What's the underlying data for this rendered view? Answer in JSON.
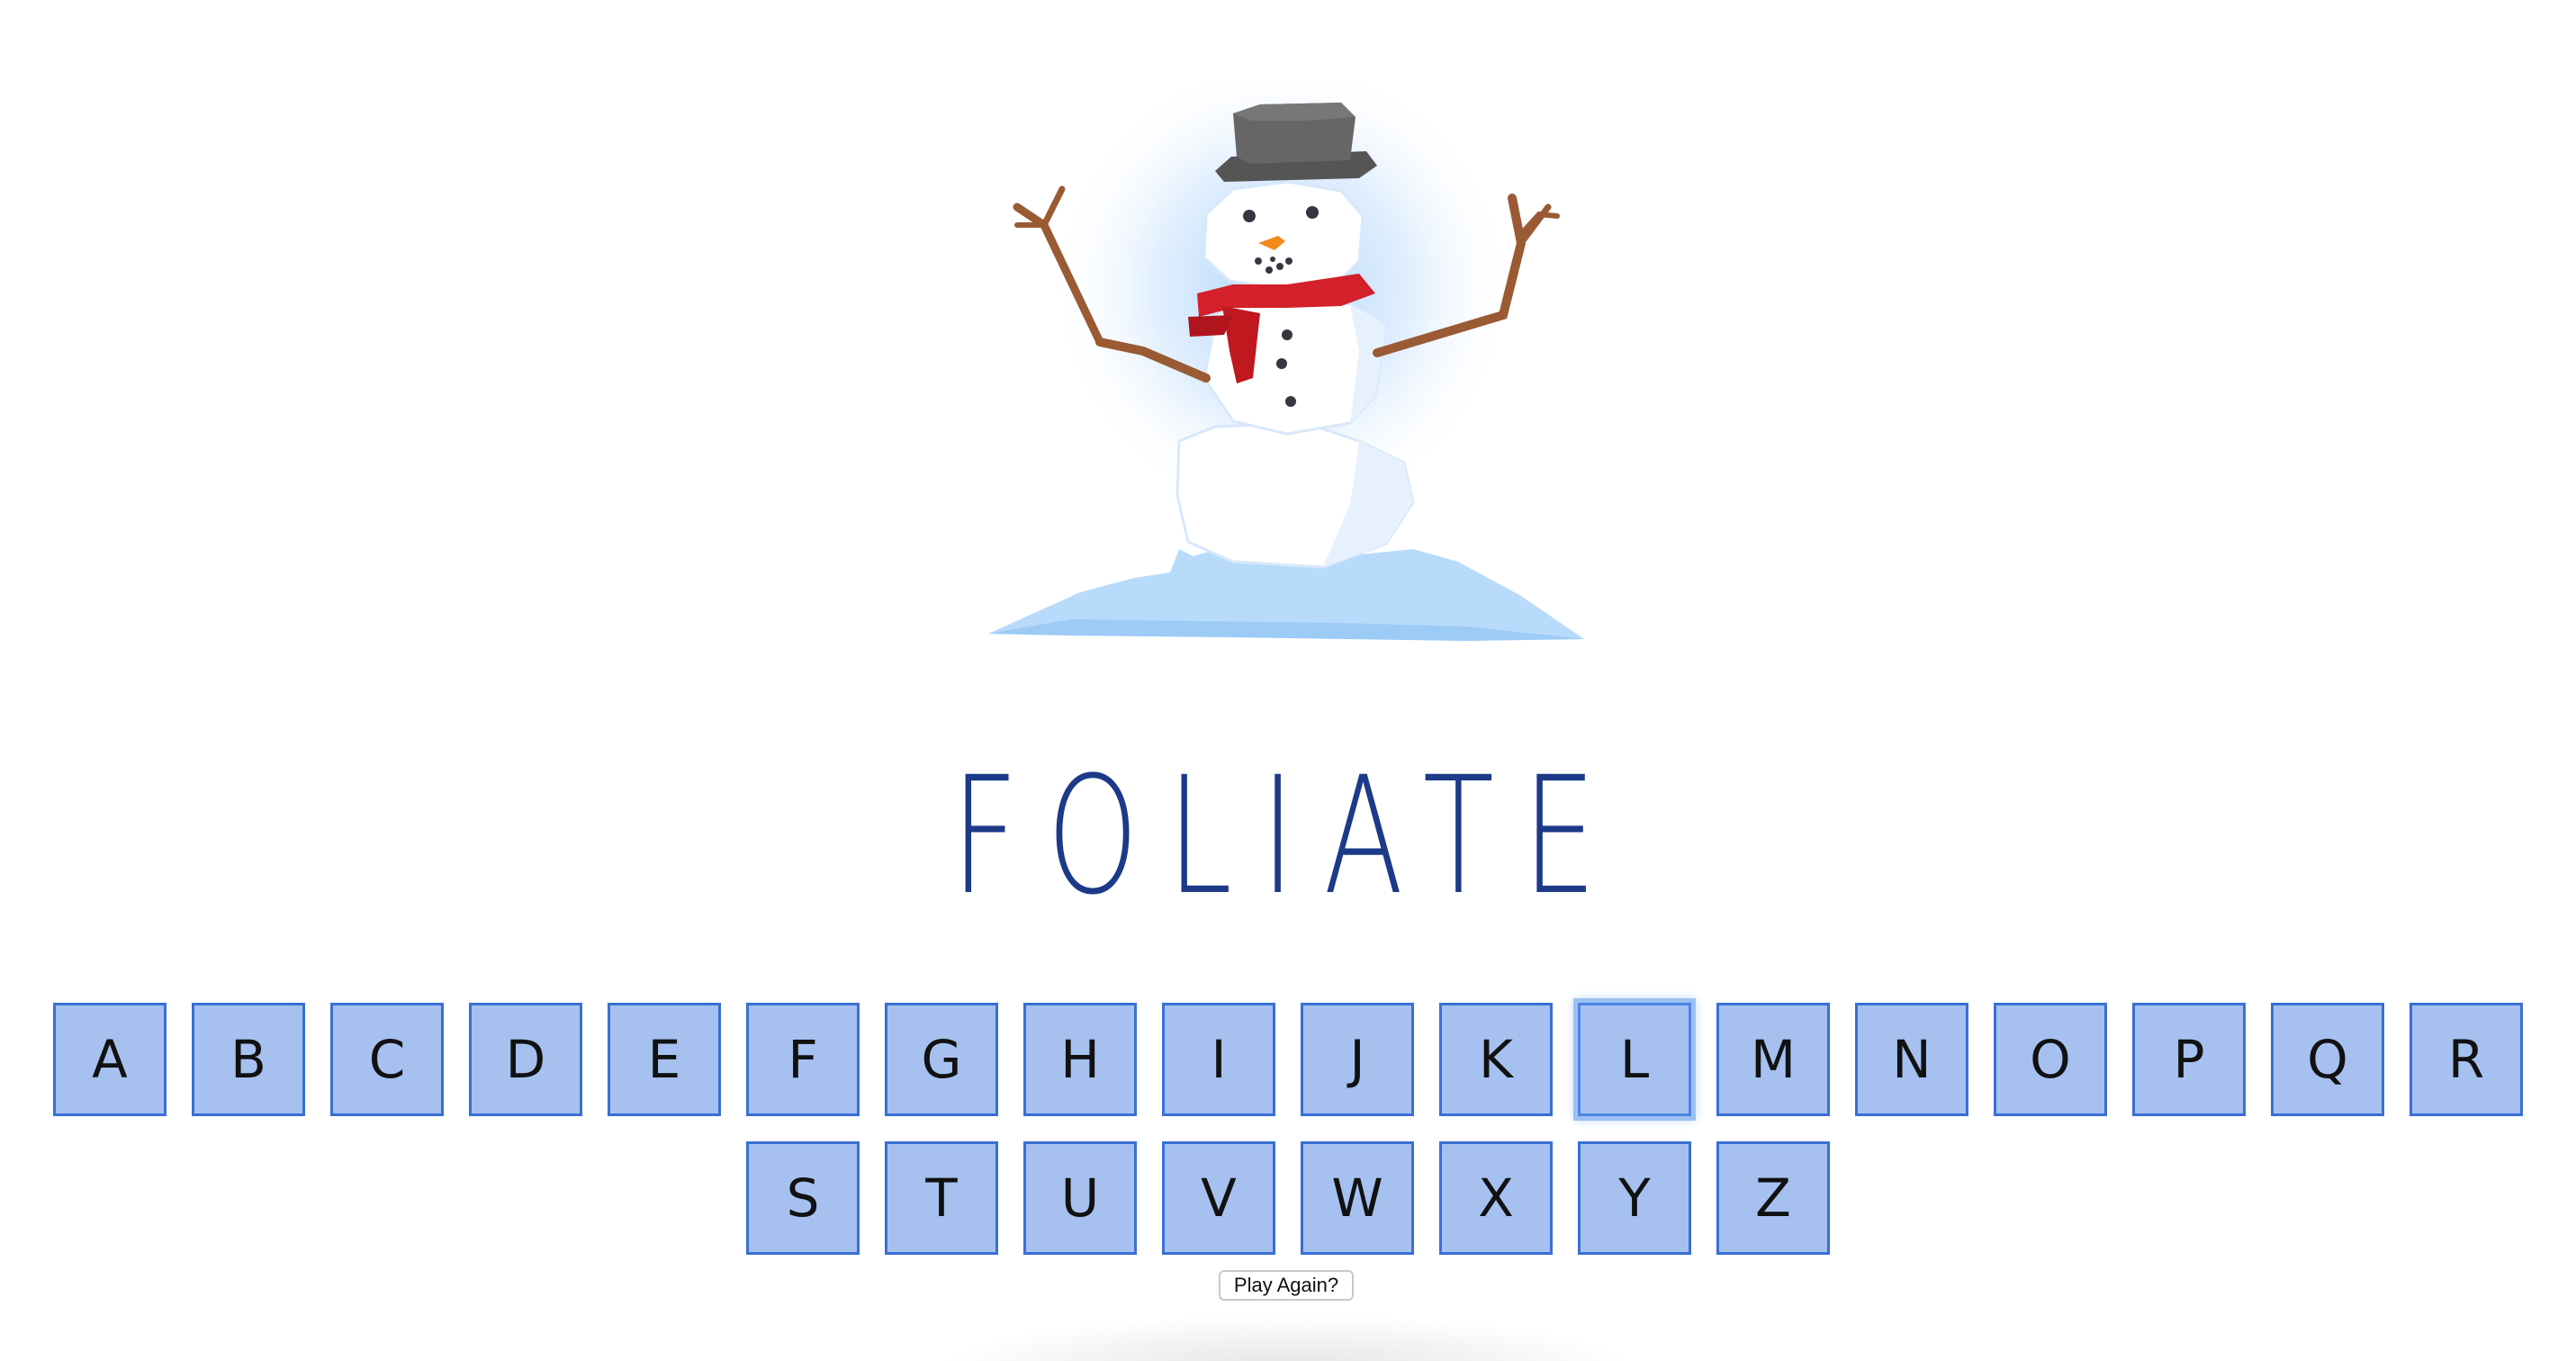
{
  "game": {
    "word": "FOLIATE",
    "illustration_icon": "snowman-icon"
  },
  "keyboard": {
    "row1": [
      "A",
      "B",
      "C",
      "D",
      "E",
      "F",
      "G",
      "H",
      "I",
      "J",
      "K",
      "L",
      "M",
      "N",
      "O",
      "P",
      "Q",
      "R"
    ],
    "row2": [
      "S",
      "T",
      "U",
      "V",
      "W",
      "X",
      "Y",
      "Z"
    ],
    "focused_key": "L"
  },
  "play_again_label": "Play Again?",
  "colors": {
    "key_fill": "#a6c1f0",
    "key_border": "#3a6fd4",
    "word_color": "#1c3a88",
    "scarf": "#d4202a",
    "hat": "#555555"
  }
}
